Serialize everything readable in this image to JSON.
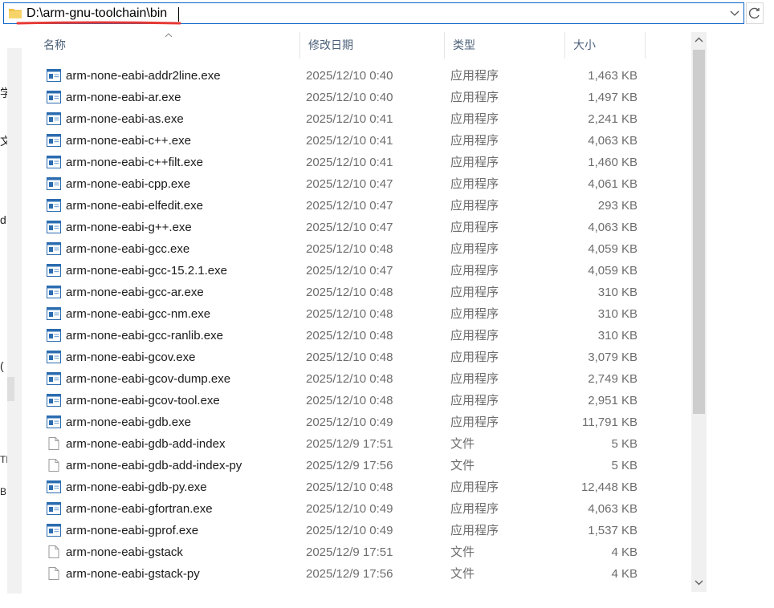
{
  "address": {
    "path": "D:\\arm-gnu-toolchain\\bin",
    "folder_icon": "folder-icon",
    "dropdown_icon": "chevron-down-icon",
    "refresh_icon": "refresh-icon",
    "underline_color": "#e53935"
  },
  "left_pane": {
    "chars": [
      "学",
      "文",
      "d",
      "(",
      "TE",
      "B"
    ]
  },
  "columns": {
    "name": "名称",
    "date": "修改日期",
    "type": "类型",
    "size": "大小"
  },
  "files": [
    {
      "name": "arm-none-eabi-addr2line.exe",
      "date": "2025/12/10 0:40",
      "type": "应用程序",
      "size": "1,463 KB",
      "icon": "exe-icon"
    },
    {
      "name": "arm-none-eabi-ar.exe",
      "date": "2025/12/10 0:40",
      "type": "应用程序",
      "size": "1,497 KB",
      "icon": "exe-icon"
    },
    {
      "name": "arm-none-eabi-as.exe",
      "date": "2025/12/10 0:41",
      "type": "应用程序",
      "size": "2,241 KB",
      "icon": "exe-icon"
    },
    {
      "name": "arm-none-eabi-c++.exe",
      "date": "2025/12/10 0:41",
      "type": "应用程序",
      "size": "4,063 KB",
      "icon": "exe-icon"
    },
    {
      "name": "arm-none-eabi-c++filt.exe",
      "date": "2025/12/10 0:41",
      "type": "应用程序",
      "size": "1,460 KB",
      "icon": "exe-icon"
    },
    {
      "name": "arm-none-eabi-cpp.exe",
      "date": "2025/12/10 0:47",
      "type": "应用程序",
      "size": "4,061 KB",
      "icon": "exe-icon"
    },
    {
      "name": "arm-none-eabi-elfedit.exe",
      "date": "2025/12/10 0:47",
      "type": "应用程序",
      "size": "293 KB",
      "icon": "exe-icon"
    },
    {
      "name": "arm-none-eabi-g++.exe",
      "date": "2025/12/10 0:47",
      "type": "应用程序",
      "size": "4,063 KB",
      "icon": "exe-icon"
    },
    {
      "name": "arm-none-eabi-gcc.exe",
      "date": "2025/12/10 0:48",
      "type": "应用程序",
      "size": "4,059 KB",
      "icon": "exe-icon"
    },
    {
      "name": "arm-none-eabi-gcc-15.2.1.exe",
      "date": "2025/12/10 0:47",
      "type": "应用程序",
      "size": "4,059 KB",
      "icon": "exe-icon"
    },
    {
      "name": "arm-none-eabi-gcc-ar.exe",
      "date": "2025/12/10 0:48",
      "type": "应用程序",
      "size": "310 KB",
      "icon": "exe-icon"
    },
    {
      "name": "arm-none-eabi-gcc-nm.exe",
      "date": "2025/12/10 0:48",
      "type": "应用程序",
      "size": "310 KB",
      "icon": "exe-icon"
    },
    {
      "name": "arm-none-eabi-gcc-ranlib.exe",
      "date": "2025/12/10 0:48",
      "type": "应用程序",
      "size": "310 KB",
      "icon": "exe-icon"
    },
    {
      "name": "arm-none-eabi-gcov.exe",
      "date": "2025/12/10 0:48",
      "type": "应用程序",
      "size": "3,079 KB",
      "icon": "exe-icon"
    },
    {
      "name": "arm-none-eabi-gcov-dump.exe",
      "date": "2025/12/10 0:48",
      "type": "应用程序",
      "size": "2,749 KB",
      "icon": "exe-icon"
    },
    {
      "name": "arm-none-eabi-gcov-tool.exe",
      "date": "2025/12/10 0:48",
      "type": "应用程序",
      "size": "2,951 KB",
      "icon": "exe-icon"
    },
    {
      "name": "arm-none-eabi-gdb.exe",
      "date": "2025/12/10 0:49",
      "type": "应用程序",
      "size": "11,791 KB",
      "icon": "exe-icon"
    },
    {
      "name": "arm-none-eabi-gdb-add-index",
      "date": "2025/12/9 17:51",
      "type": "文件",
      "size": "5 KB",
      "icon": "file-icon"
    },
    {
      "name": "arm-none-eabi-gdb-add-index-py",
      "date": "2025/12/9 17:56",
      "type": "文件",
      "size": "5 KB",
      "icon": "file-icon"
    },
    {
      "name": "arm-none-eabi-gdb-py.exe",
      "date": "2025/12/10 0:48",
      "type": "应用程序",
      "size": "12,448 KB",
      "icon": "exe-icon"
    },
    {
      "name": "arm-none-eabi-gfortran.exe",
      "date": "2025/12/10 0:49",
      "type": "应用程序",
      "size": "4,063 KB",
      "icon": "exe-icon"
    },
    {
      "name": "arm-none-eabi-gprof.exe",
      "date": "2025/12/10 0:49",
      "type": "应用程序",
      "size": "1,537 KB",
      "icon": "exe-icon"
    },
    {
      "name": "arm-none-eabi-gstack",
      "date": "2025/12/9 17:51",
      "type": "文件",
      "size": "4 KB",
      "icon": "file-icon"
    },
    {
      "name": "arm-none-eabi-gstack-py",
      "date": "2025/12/9 17:56",
      "type": "文件",
      "size": "4 KB",
      "icon": "file-icon"
    }
  ],
  "scrollbar": {
    "up_icon": "chevron-up-icon",
    "down_icon": "chevron-down-icon"
  }
}
